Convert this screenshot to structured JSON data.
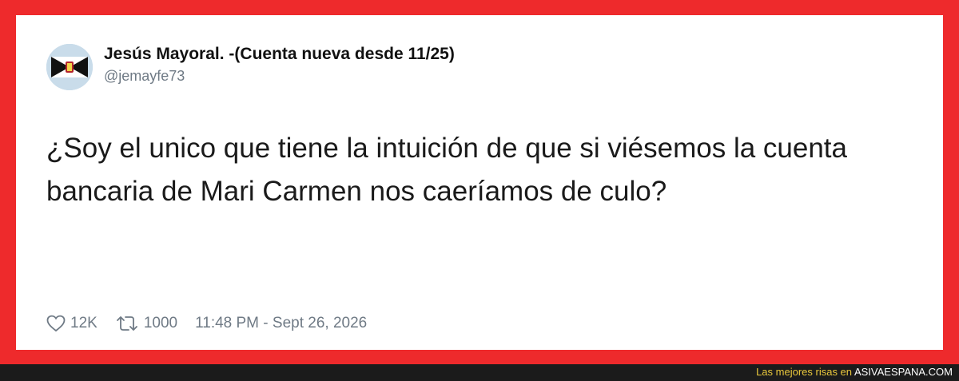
{
  "tweet": {
    "display_name": "Jesús Mayoral. -(Cuenta nueva desde 11/25)",
    "handle": "@jemayfe73",
    "text": "¿Soy el unico que tiene la intuición de que si viésemos la cuenta bancaria de Mari Carmen nos caeríamos de culo?",
    "likes": "12K",
    "retweets": "1000",
    "timestamp": "11:48 PM - Sept 26, 2026",
    "icons": {
      "like": "heart-icon",
      "retweet": "retweet-icon"
    }
  },
  "watermark": {
    "prefix": "Las mejores risas en",
    "site": "ASIVAESPANA.COM"
  },
  "colors": {
    "frame": "#ee2a2c",
    "card": "#ffffff",
    "text": "#1a1a1a",
    "muted": "#6f7a85",
    "bottom_bar": "#1b1b1b",
    "watermark_text": "#e9c83c"
  }
}
